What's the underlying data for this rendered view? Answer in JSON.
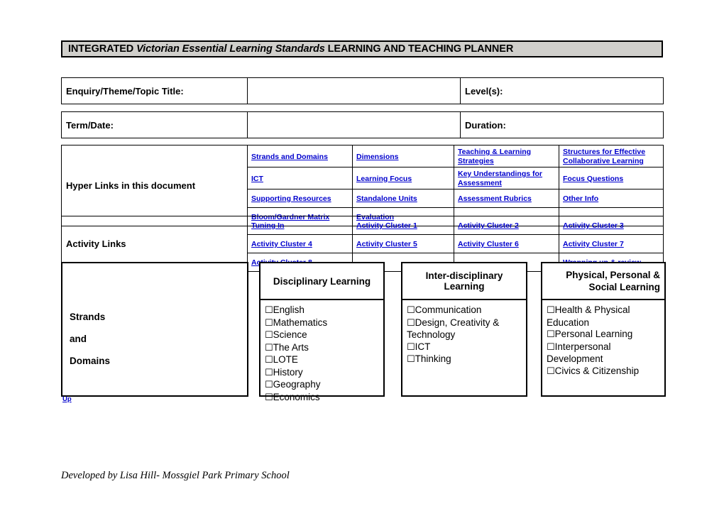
{
  "document": {
    "title_prefix": "INTEGRATED ",
    "title_italic": "Victorian Essential Learning Standards",
    "title_suffix": " LEARNING AND TEACHING PLANNER",
    "footer": "Developed by Lisa Hill- Mossgiel Park Primary School",
    "up_link": "Up",
    "link_color": "#0000cd",
    "banner_bg": "#d0cfcb"
  },
  "info_rows": [
    {
      "label": "Enquiry/Theme/Topic Title:",
      "value": "",
      "right_label": "Level(s):",
      "right_value": ""
    },
    {
      "label": "Term/Date:",
      "value": "",
      "right_label": "Duration:",
      "right_value": ""
    }
  ],
  "hyper_links": {
    "label": "Hyper Links in this document",
    "rows": [
      [
        "Strands and Domains",
        "Dimensions",
        "Teaching & Learning Strategies",
        "Structures for Effective Collaborative Learning"
      ],
      [
        "ICT",
        "Learning Focus",
        "Key Understandings for Assessment",
        "Focus Questions"
      ],
      [
        "Supporting Resources",
        "Standalone Units",
        "Assessment Rubrics",
        "Other Info"
      ],
      [
        "Bloom/Gardner Matrix",
        "Evaluation",
        "",
        ""
      ]
    ]
  },
  "activity_links": {
    "label": "Activity Links",
    "rows": [
      [
        "Tuning In ",
        "Activity Cluster 1",
        "Activity Cluster 2",
        "Activity Cluster 3"
      ],
      [
        "Activity Cluster 4",
        "Activity Cluster 5",
        "Activity Cluster 6",
        "Activity Cluster 7"
      ],
      [
        "Activity Cluster 8",
        "",
        "",
        "Wrapping up & review"
      ]
    ]
  },
  "strands": {
    "label_lines": [
      "Strands",
      "and",
      "Domains"
    ],
    "columns": [
      {
        "heading": "Disciplinary Learning",
        "items": [
          "English",
          "Mathematics",
          "Science",
          "The Arts",
          "LOTE",
          "History",
          "Geography",
          "Economics"
        ]
      },
      {
        "heading": "Inter-disciplinary Learning",
        "items": [
          "Communication",
          "Design, Creativity & Technology",
          "ICT",
          "Thinking"
        ]
      },
      {
        "heading": "Physical, Personal  & Social Learning",
        "heading_line1": "Physical, Personal  &",
        "heading_line2": "Social Learning",
        "items": [
          "Health & Physical Education",
          "Personal Learning",
          "Interpersonal Development",
          "Civics & Citizenship"
        ]
      }
    ],
    "checkbox_glyph": "☐"
  }
}
